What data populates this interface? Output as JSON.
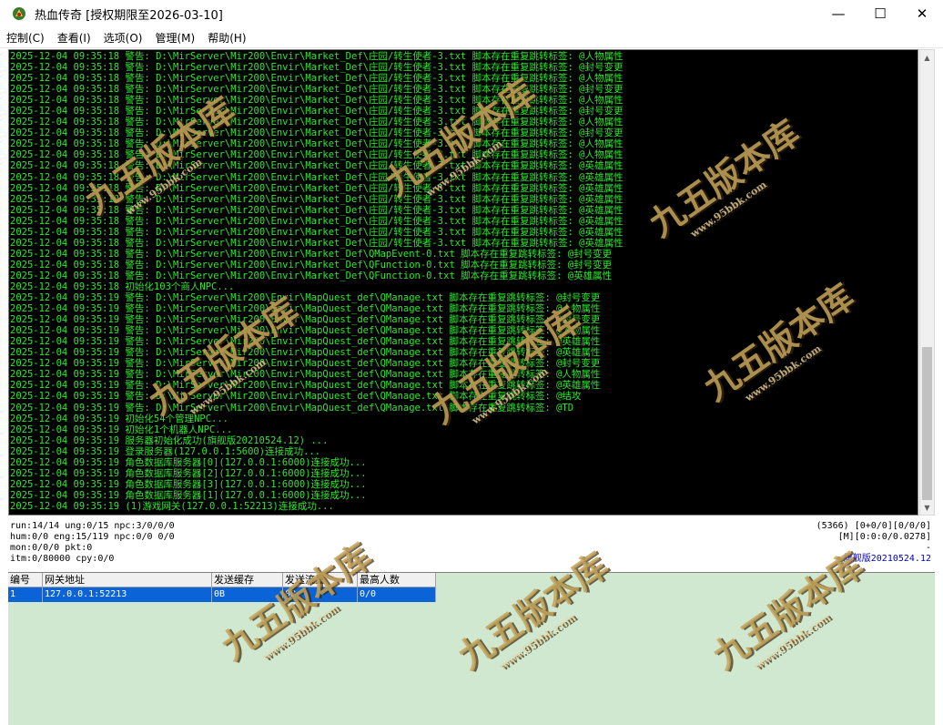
{
  "window": {
    "title": "热血传奇 [授权期限至2026-03-10]",
    "minimize": "—",
    "maximize": "☐",
    "close": "✕"
  },
  "menu": [
    "控制(C)",
    "查看(I)",
    "选项(O)",
    "管理(M)",
    "帮助(H)"
  ],
  "log_lines": [
    "2025-12-04 09:35:18 警告: D:\\MirServer\\Mir200\\Envir\\Market_Def\\庄园/转生使者-3.txt 脚本存在重复跳转标签: @人物属性",
    "2025-12-04 09:35:18 警告: D:\\MirServer\\Mir200\\Envir\\Market_Def\\庄园/转生使者-3.txt 脚本存在重复跳转标签: @封号变更",
    "2025-12-04 09:35:18 警告: D:\\MirServer\\Mir200\\Envir\\Market_Def\\庄园/转生使者-3.txt 脚本存在重复跳转标签: @人物属性",
    "2025-12-04 09:35:18 警告: D:\\MirServer\\Mir200\\Envir\\Market_Def\\庄园/转生使者-3.txt 脚本存在重复跳转标签: @封号变更",
    "2025-12-04 09:35:18 警告: D:\\MirServer\\Mir200\\Envir\\Market_Def\\庄园/转生使者-3.txt 脚本存在重复跳转标签: @人物属性",
    "2025-12-04 09:35:18 警告: D:\\MirServer\\Mir200\\Envir\\Market_Def\\庄园/转生使者-3.txt 脚本存在重复跳转标签: @封号变更",
    "2025-12-04 09:35:18 警告: D:\\MirServer\\Mir200\\Envir\\Market_Def\\庄园/转生使者-3.txt 脚本存在重复跳转标签: @人物属性",
    "2025-12-04 09:35:18 警告: D:\\MirServer\\Mir200\\Envir\\Market_Def\\庄园/转生使者-3.txt 脚本存在重复跳转标签: @封号变更",
    "2025-12-04 09:35:18 警告: D:\\MirServer\\Mir200\\Envir\\Market_Def\\庄园/转生使者-3.txt 脚本存在重复跳转标签: @人物属性",
    "2025-12-04 09:35:18 警告: D:\\MirServer\\Mir200\\Envir\\Market_Def\\庄园/转生使者-3.txt 脚本存在重复跳转标签: @人物属性",
    "2025-12-04 09:35:18 警告: D:\\MirServer\\Mir200\\Envir\\Market_Def\\庄园/转生使者-3.txt 脚本存在重复跳转标签: @英雄属性",
    "2025-12-04 09:35:18 警告: D:\\MirServer\\Mir200\\Envir\\Market_Def\\庄园/转生使者-3.txt 脚本存在重复跳转标签: @英雄属性",
    "2025-12-04 09:35:18 警告: D:\\MirServer\\Mir200\\Envir\\Market_Def\\庄园/转生使者-3.txt 脚本存在重复跳转标签: @英雄属性",
    "2025-12-04 09:35:18 警告: D:\\MirServer\\Mir200\\Envir\\Market_Def\\庄园/转生使者-3.txt 脚本存在重复跳转标签: @英雄属性",
    "2025-12-04 09:35:18 警告: D:\\MirServer\\Mir200\\Envir\\Market_Def\\庄园/转生使者-3.txt 脚本存在重复跳转标签: @英雄属性",
    "2025-12-04 09:35:18 警告: D:\\MirServer\\Mir200\\Envir\\Market_Def\\庄园/转生使者-3.txt 脚本存在重复跳转标签: @英雄属性",
    "2025-12-04 09:35:18 警告: D:\\MirServer\\Mir200\\Envir\\Market_Def\\庄园/转生使者-3.txt 脚本存在重复跳转标签: @英雄属性",
    "2025-12-04 09:35:18 警告: D:\\MirServer\\Mir200\\Envir\\Market_Def\\庄园/转生使者-3.txt 脚本存在重复跳转标签: @英雄属性",
    "2025-12-04 09:35:18 警告: D:\\MirServer\\Mir200\\Envir\\Market_Def\\QMapEvent-0.txt 脚本存在重复跳转标签: @封号变更",
    "2025-12-04 09:35:18 警告: D:\\MirServer\\Mir200\\Envir\\Market_Def\\QFunction-0.txt 脚本存在重复跳转标签: @封号变更",
    "2025-12-04 09:35:18 警告: D:\\MirServer\\Mir200\\Envir\\Market_Def\\QFunction-0.txt 脚本存在重复跳转标签: @英雄属性",
    "2025-12-04 09:35:18 初始化103个商人NPC...",
    "2025-12-04 09:35:19 警告: D:\\MirServer\\Mir200\\Envir\\MapQuest_def\\QManage.txt 脚本存在重复跳转标签: @封号变更",
    "2025-12-04 09:35:19 警告: D:\\MirServer\\Mir200\\Envir\\MapQuest_def\\QManage.txt 脚本存在重复跳转标签: @人物属性",
    "2025-12-04 09:35:19 警告: D:\\MirServer\\Mir200\\Envir\\MapQuest_def\\QManage.txt 脚本存在重复跳转标签: @封号变更",
    "2025-12-04 09:35:19 警告: D:\\MirServer\\Mir200\\Envir\\MapQuest_def\\QManage.txt 脚本存在重复跳转标签: @人物属性",
    "2025-12-04 09:35:19 警告: D:\\MirServer\\Mir200\\Envir\\MapQuest_def\\QManage.txt 脚本存在重复跳转标签: @英雄属性",
    "2025-12-04 09:35:19 警告: D:\\MirServer\\Mir200\\Envir\\MapQuest_def\\QManage.txt 脚本存在重复跳转标签: @英雄属性",
    "2025-12-04 09:35:19 警告: D:\\MirServer\\Mir200\\Envir\\MapQuest_def\\QManage.txt 脚本存在重复跳转标签: @封号变更",
    "2025-12-04 09:35:19 警告: D:\\MirServer\\Mir200\\Envir\\MapQuest_def\\QManage.txt 脚本存在重复跳转标签: @人物属性",
    "2025-12-04 09:35:19 警告: D:\\MirServer\\Mir200\\Envir\\MapQuest_def\\QManage.txt 脚本存在重复跳转标签: @英雄属性",
    "2025-12-04 09:35:19 警告: D:\\MirServer\\Mir200\\Envir\\MapQuest_def\\QManage.txt 脚本存在重复跳转标签: @结攻",
    "2025-12-04 09:35:19 警告: D:\\MirServer\\Mir200\\Envir\\MapQuest_def\\QManage.txt 脚本存在重复跳转标签: @TD",
    "2025-12-04 09:35:19 初始化54个管理NPC...",
    "2025-12-04 09:35:19 初始化1个机器人NPC...",
    "2025-12-04 09:35:19 服务器初始化成功(旗舰版20210524.12) ...",
    "2025-12-04 09:35:19 登录服务器(127.0.0.1:5600)连接成功...",
    "2025-12-04 09:35:19 角色数据库服务器[0](127.0.0.1:6000)连接成功...",
    "2025-12-04 09:35:19 角色数据库服务器[2](127.0.0.1:6000)连接成功...",
    "2025-12-04 09:35:19 角色数据库服务器[3](127.0.0.1:6000)连接成功...",
    "2025-12-04 09:35:19 角色数据库服务器[1](127.0.0.1:6000)连接成功...",
    "2025-12-04 09:35:19 (1)游戏网关(127.0.0.1:52213)连接成功..."
  ],
  "status": {
    "left": [
      "run:14/14 ung:0/15 npc:3/0/0/0",
      "hum:0/0 eng:15/119 npc:0/0 0/0",
      "mon:0/0/0 pkt:0",
      "itm:0/80000 cpy:0/0"
    ],
    "right": [
      "(5366) [0+0/0][0/0/0]",
      "[M][0:0:0/0.0278]",
      "-",
      "旗舰版20210524.12"
    ]
  },
  "table": {
    "headers": [
      "编号",
      "网关地址",
      "发送缓存",
      "发送流量",
      "最高人数"
    ],
    "rows": [
      [
        "1",
        "127.0.0.1:52213",
        "0B",
        "0B",
        "0/0"
      ]
    ]
  },
  "watermark": {
    "logo": "九五版本库",
    "url": "www.95bbk.com"
  },
  "colors": {
    "log_text": "#2fe62f",
    "grid_bg": "#cfe8cf",
    "selection": "#0a64d8",
    "edition": "#0000c0"
  }
}
